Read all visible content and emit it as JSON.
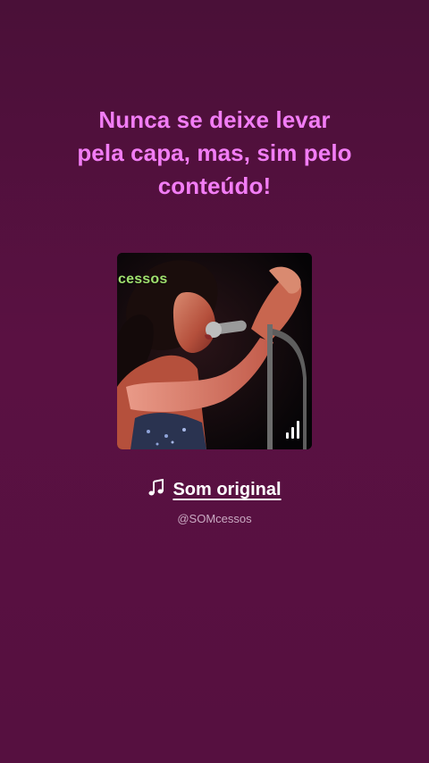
{
  "caption": {
    "line1": "Nunca se deixe levar",
    "line2": "pela capa, mas, sim pelo",
    "line3": "conteúdo!"
  },
  "cover": {
    "tag": "cessos",
    "icon": "audio-bars-icon"
  },
  "audio": {
    "icon": "music-note-icon",
    "title": "Som original",
    "handle": "@SOMcessos"
  },
  "colors": {
    "caption": "#f27df5",
    "background": "#561040",
    "tag": "#9ee06e"
  }
}
